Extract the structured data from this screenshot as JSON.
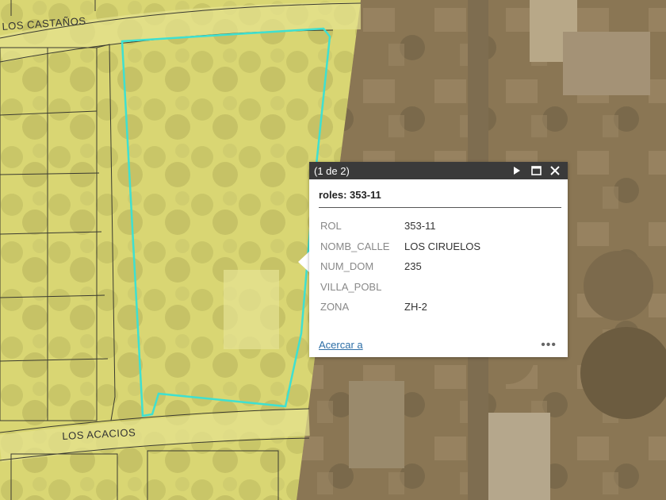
{
  "map": {
    "streets": [
      "LOS CASTAÑOS",
      "LOS ACACIOS"
    ],
    "colors": {
      "zone_fill": "#d8d675",
      "imagery": "#8b7855",
      "parcel_highlight": "#3fe0d0",
      "parcel_lines": "#333333"
    }
  },
  "popup": {
    "counter": "(1 de 2)",
    "icons": {
      "next": "play-icon",
      "maximize": "maximize-icon",
      "close": "close-icon",
      "more": "ellipsis-icon"
    },
    "title": "roles: 353-11",
    "attributes": [
      {
        "key": "ROL",
        "value": "353-11"
      },
      {
        "key": "NOMB_CALLE",
        "value": "LOS CIRUELOS"
      },
      {
        "key": "NUM_DOM",
        "value": "235"
      },
      {
        "key": "VILLA_POBL",
        "value": ""
      },
      {
        "key": "ZONA",
        "value": "ZH-2"
      }
    ],
    "zoom_link": "Acercar a",
    "more_label": "•••"
  }
}
